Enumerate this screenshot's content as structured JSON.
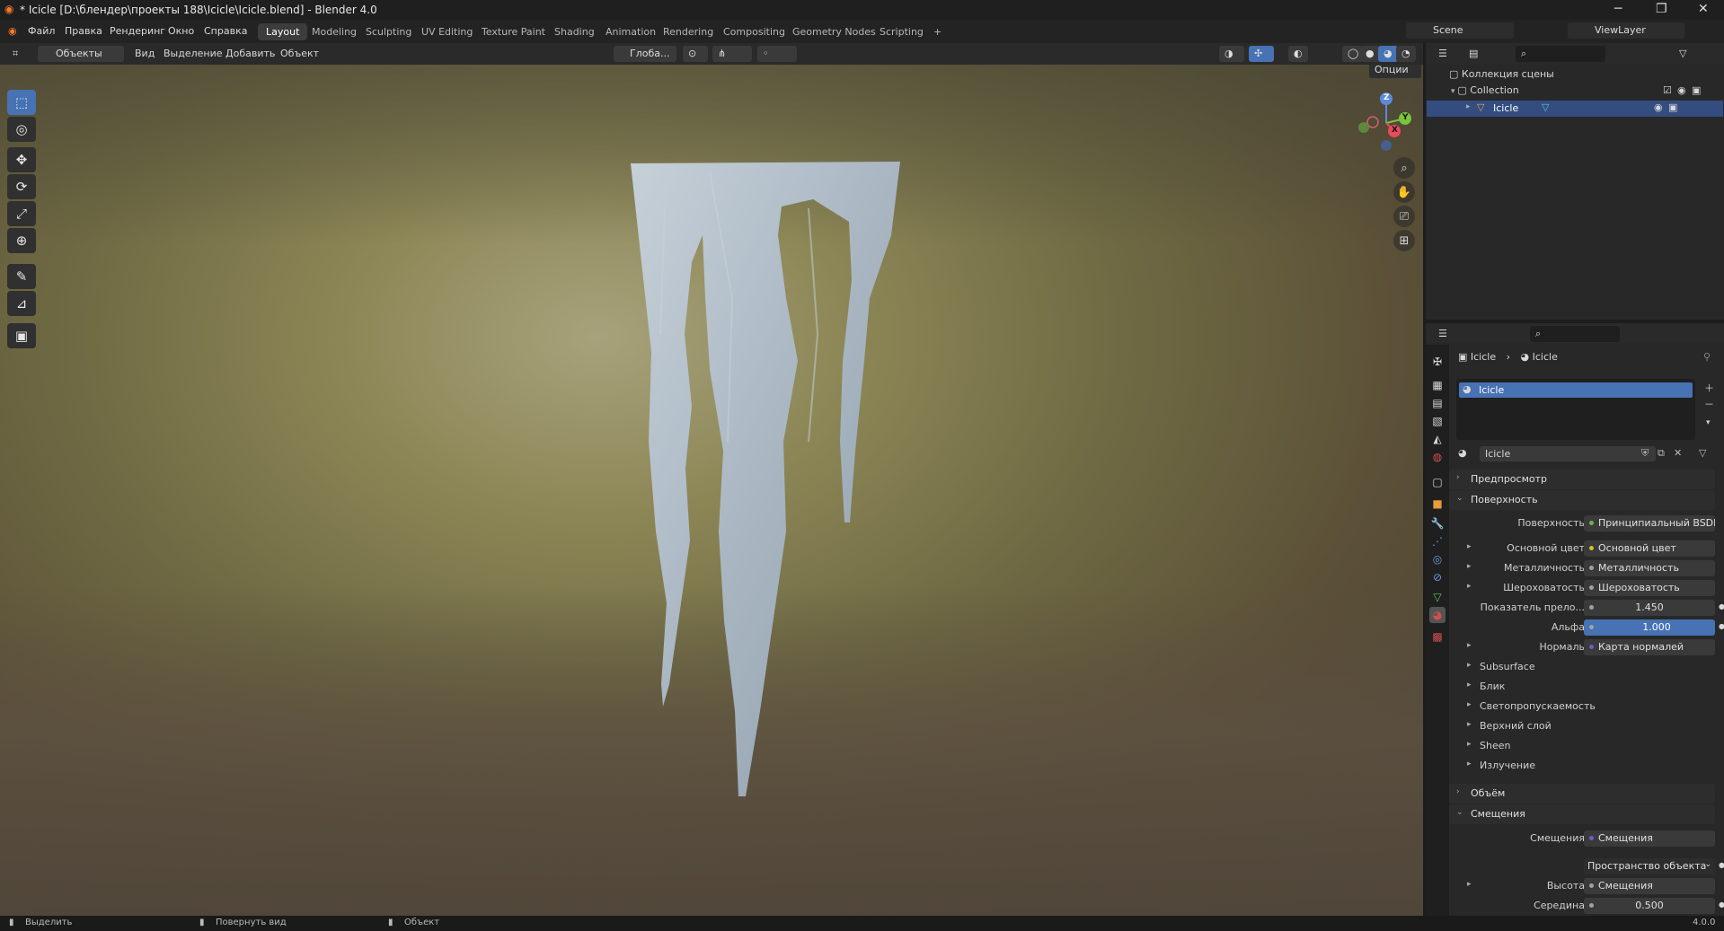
{
  "window": {
    "title": "* Icicle [D:\\блендер\\проекты 188\\Icicle\\Icicle.blend] - Blender 4.0",
    "min": "─",
    "max": "❐",
    "close": "✕"
  },
  "menu": [
    "Файл",
    "Правка",
    "Рендеринг",
    "Окно",
    "Справка"
  ],
  "workspaces": [
    "Layout",
    "Modeling",
    "Sculpting",
    "UV Editing",
    "Texture Paint",
    "Shading",
    "Animation",
    "Rendering",
    "Compositing",
    "Geometry Nodes",
    "Scripting"
  ],
  "add_tab": "+",
  "scene": {
    "name": "Scene",
    "viewlayer": "ViewLayer"
  },
  "viewport_header": {
    "mode": "Объекты",
    "items": [
      "Вид",
      "Выделение",
      "Добавить",
      "Объект"
    ],
    "transform": "Глоба...",
    "options": "Опции"
  },
  "tools": [
    {
      "icon": "select-box-icon",
      "glyph": "⬚"
    },
    {
      "icon": "cursor-icon",
      "glyph": "◎"
    },
    {
      "icon": "move-icon",
      "glyph": "✥"
    },
    {
      "icon": "rotate-icon",
      "glyph": "⟳"
    },
    {
      "icon": "scale-icon",
      "glyph": "⤢"
    },
    {
      "icon": "transform-icon",
      "glyph": "⊕"
    },
    {
      "icon": "annotate-icon",
      "glyph": "✎"
    },
    {
      "icon": "measure-icon",
      "glyph": "📐"
    },
    {
      "icon": "add-cube-icon",
      "glyph": "▣"
    }
  ],
  "gizmo": {
    "x": "X",
    "y": "Y",
    "z": "Z"
  },
  "outliner": {
    "root": "Коллекция сцены",
    "collection": "Collection",
    "object": "Icicle"
  },
  "props": {
    "breadcrumb": [
      "Icicle",
      "Icicle"
    ],
    "material_slot": "Icicle",
    "material_name": "Icicle",
    "panels": {
      "preview": "Предпросмотр",
      "surface": "Поверхность",
      "volume": "Объём",
      "displacement": "Смещения"
    },
    "surface_rows": [
      {
        "label": "Поверхность",
        "value": "Принципиальный BSDF",
        "dot": "#6fb24a"
      },
      {
        "label": "Основной цвет",
        "value": "Основной цвет",
        "dot": "#c7c729",
        "expand": true
      },
      {
        "label": "Металличность",
        "value": "Металличность",
        "dot": "#a1a1a1",
        "expand": true
      },
      {
        "label": "Шероховатость",
        "value": "Шероховатость",
        "dot": "#a1a1a1",
        "expand": true
      },
      {
        "label": "Показатель прело...",
        "value": "1.450",
        "dot": "#a1a1a1",
        "num": true
      },
      {
        "label": "Альфа",
        "value": "1.000",
        "dot": "#a1a1a1",
        "num": true,
        "blue": true
      },
      {
        "label": "Нормаль",
        "value": "Карта нормалей",
        "dot": "#6363c7",
        "expand": true
      }
    ],
    "subpanels": [
      "Subsurface",
      "Блик",
      "Светопропускаемость",
      "Верхний слой",
      "Sheen",
      "Излучение"
    ],
    "displacement_rows": [
      {
        "label": "Смещения",
        "value": "Смещения",
        "dot": "#6363c7"
      },
      {
        "label": "",
        "value": "Пространство объекта",
        "dropdown": true
      },
      {
        "label": "Высота",
        "value": "Смещения",
        "dot": "#a1a1a1",
        "expand": true
      },
      {
        "label": "Середина",
        "value": "0.500",
        "dot": "#a1a1a1",
        "num": true
      }
    ]
  },
  "status": {
    "select": "Выделить",
    "rotate": "Повернуть вид",
    "object": "Объект",
    "version": "4.0.0"
  }
}
